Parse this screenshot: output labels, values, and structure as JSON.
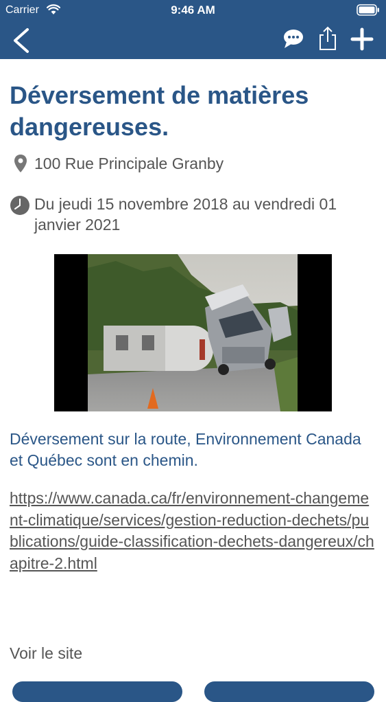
{
  "status_bar": {
    "carrier": "Carrier",
    "time": "9:46 AM",
    "wifi_icon": "wifi-icon",
    "battery_icon": "battery-icon"
  },
  "nav": {
    "back_icon": "chevron-left-icon",
    "chat_icon": "chat-bubble-icon",
    "share_icon": "share-icon",
    "add_icon": "plus-icon"
  },
  "event": {
    "title": "Déversement de matières dangereuses.",
    "address": "100 Rue Principale Granby",
    "date": "Du jeudi 15 novembre 2018 au vendredi 01 janvier 2021",
    "description": "Déversement sur la route, Environnement Canada et Québec sont en chemin.",
    "link": "https://www.canada.ca/fr/environnement-changement-climatique/services/gestion-reduction-dechets/publications/guide-classification-dechets-dangereux/chapitre-2.html",
    "visit_label": "Voir le site"
  },
  "colors": {
    "brand": "#2a5687",
    "text_gray": "#555555"
  }
}
